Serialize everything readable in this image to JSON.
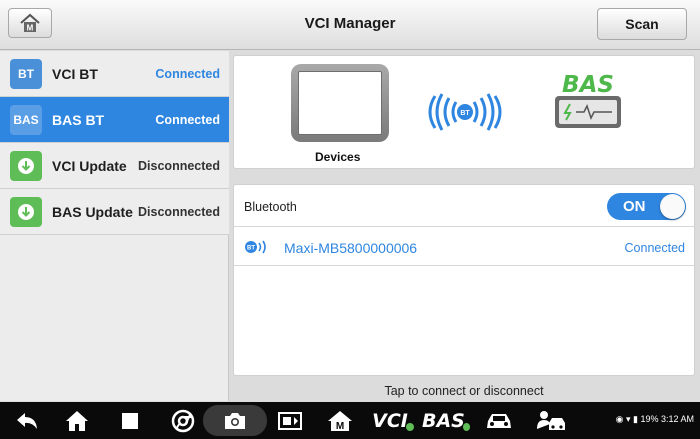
{
  "header": {
    "title": "VCI Manager",
    "home_icon": "home-m-icon",
    "scan_label": "Scan"
  },
  "sidebar": {
    "items": [
      {
        "icon_text": "BT",
        "label": "VCI BT",
        "status": "Connected",
        "active": false
      },
      {
        "icon_text": "BAS",
        "label": "BAS BT",
        "status": "Connected",
        "active": true
      },
      {
        "icon_text": "",
        "icon": "download-icon",
        "label": "VCI Update",
        "status": "Disconnected",
        "active": false
      },
      {
        "icon_text": "",
        "icon": "download-icon",
        "label": "BAS Update",
        "status": "Disconnected",
        "active": false
      }
    ]
  },
  "devices": {
    "tablet_label": "Devices",
    "bas_text": "BAS",
    "bt_text": "BT"
  },
  "bluetooth": {
    "label": "Bluetooth",
    "toggle": "ON",
    "device_name": "Maxi-MB5800000006",
    "device_status": "Connected"
  },
  "hint": "Tap to connect or disconnect",
  "taskbar": {
    "vci_text": "VCI",
    "bas_text": "BAS",
    "status_text": "19% 3:12 AM"
  },
  "colors": {
    "accent": "#2f86e0",
    "green": "#5fbd57"
  }
}
